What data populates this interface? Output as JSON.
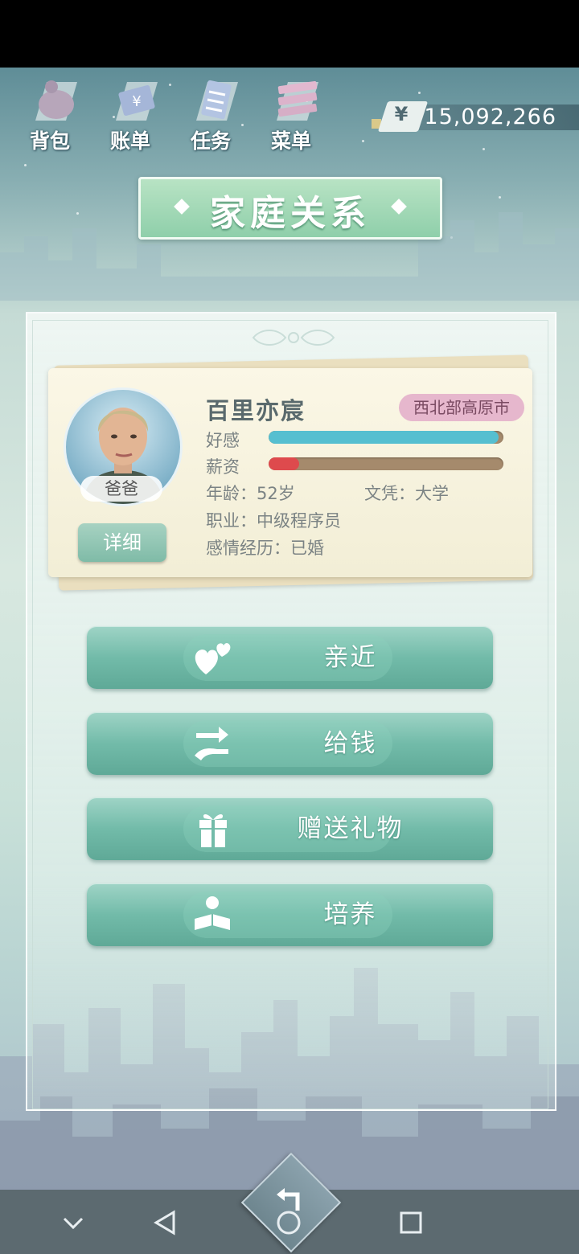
{
  "toolbar": {
    "items": [
      {
        "label": "背包",
        "icon": "bag-icon"
      },
      {
        "label": "账单",
        "icon": "bill-icon"
      },
      {
        "label": "任务",
        "icon": "task-icon"
      },
      {
        "label": "菜单",
        "icon": "menu-icon"
      }
    ],
    "currency_symbol": "¥",
    "money": "15,092,266"
  },
  "page": {
    "title": "家庭关系"
  },
  "character": {
    "name": "百里亦宸",
    "relation": "爸爸",
    "region": "西北部高原市",
    "detail_button": "详细",
    "stats": [
      {
        "label": "好感",
        "value": 0.98,
        "color": "#56bfd0"
      },
      {
        "label": "薪资",
        "value": 0.13,
        "color": "#de4a4d"
      }
    ],
    "age": "年龄：52岁",
    "education": "文凭：大学",
    "job": "职业：中级程序员",
    "relationship": "感情经历：已婚"
  },
  "actions": [
    {
      "label": "亲近",
      "icon": "hearts-icon"
    },
    {
      "label": "给钱",
      "icon": "give-money-icon"
    },
    {
      "label": "赠送礼物",
      "icon": "gift-icon"
    },
    {
      "label": "培养",
      "icon": "reading-icon"
    }
  ],
  "nav": {
    "icons": [
      "chevron-down-icon",
      "back-triangle-icon",
      "home-circle-icon",
      "recents-square-icon"
    ]
  }
}
